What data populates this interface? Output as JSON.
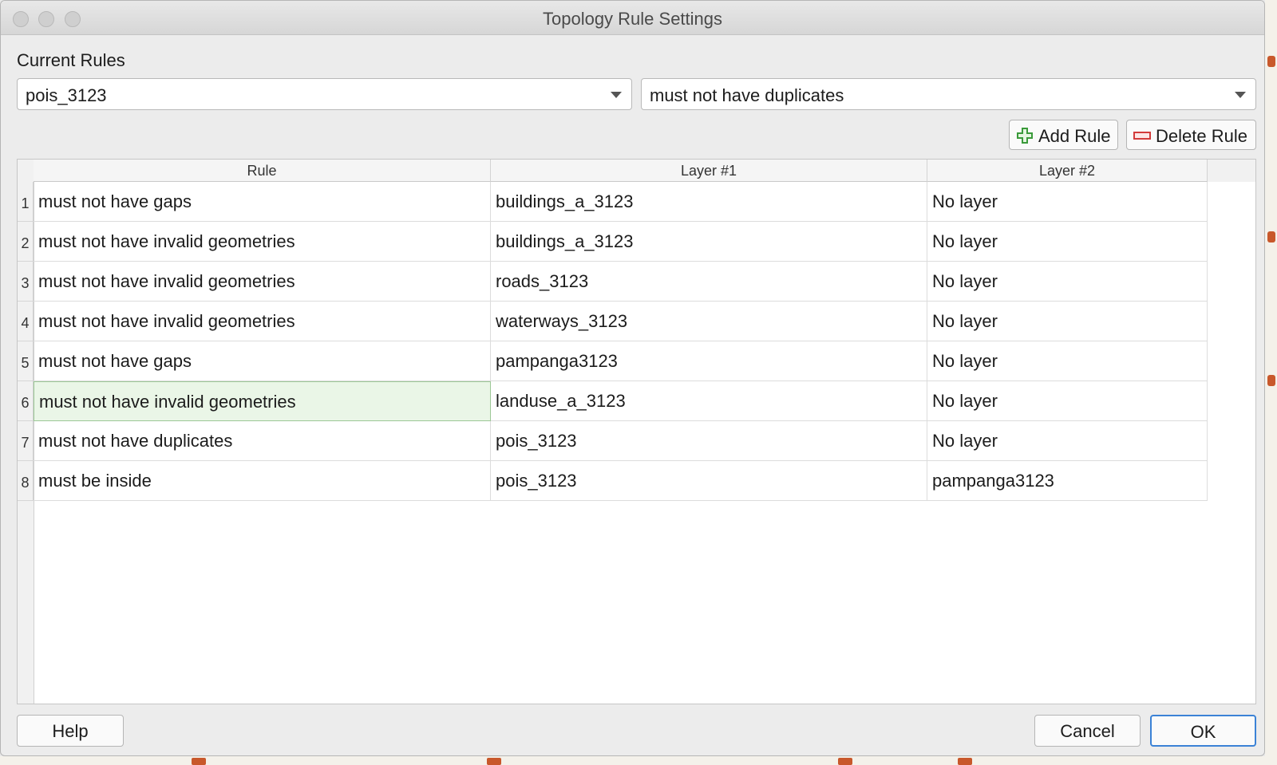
{
  "window": {
    "title": "Topology Rule Settings"
  },
  "current_rules": {
    "label": "Current Rules",
    "layer_combo": {
      "value": "pois_3123"
    },
    "rule_combo": {
      "value": "must not have duplicates"
    }
  },
  "toolbar": {
    "add_rule_label": "Add Rule",
    "delete_rule_label": "Delete Rule"
  },
  "table": {
    "columns": [
      "Rule",
      "Layer #1",
      "Layer #2"
    ],
    "rows": [
      {
        "num": "1",
        "rule": "must not have gaps",
        "layer1": "buildings_a_3123",
        "layer2": "No layer"
      },
      {
        "num": "2",
        "rule": "must not have invalid geometries",
        "layer1": "buildings_a_3123",
        "layer2": "No layer"
      },
      {
        "num": "3",
        "rule": "must not have invalid geometries",
        "layer1": "roads_3123",
        "layer2": "No layer"
      },
      {
        "num": "4",
        "rule": "must not have invalid geometries",
        "layer1": "waterways_3123",
        "layer2": "No layer"
      },
      {
        "num": "5",
        "rule": "must not have gaps",
        "layer1": "pampanga3123",
        "layer2": "No layer"
      },
      {
        "num": "6",
        "rule": "must not have invalid geometries",
        "layer1": "landuse_a_3123",
        "layer2": "No layer"
      },
      {
        "num": "7",
        "rule": "must not have duplicates",
        "layer1": "pois_3123",
        "layer2": "No layer"
      },
      {
        "num": "8",
        "rule": "must be inside",
        "layer1": "pois_3123",
        "layer2": "pampanga3123"
      }
    ],
    "selected_row": 6
  },
  "footer": {
    "help_label": "Help",
    "cancel_label": "Cancel",
    "ok_label": "OK"
  },
  "colors": {
    "accent": "#3b82d6",
    "selection_bg": "#eaf6e7",
    "add_icon": "#3a9a3a",
    "delete_icon": "#d33a3a"
  }
}
